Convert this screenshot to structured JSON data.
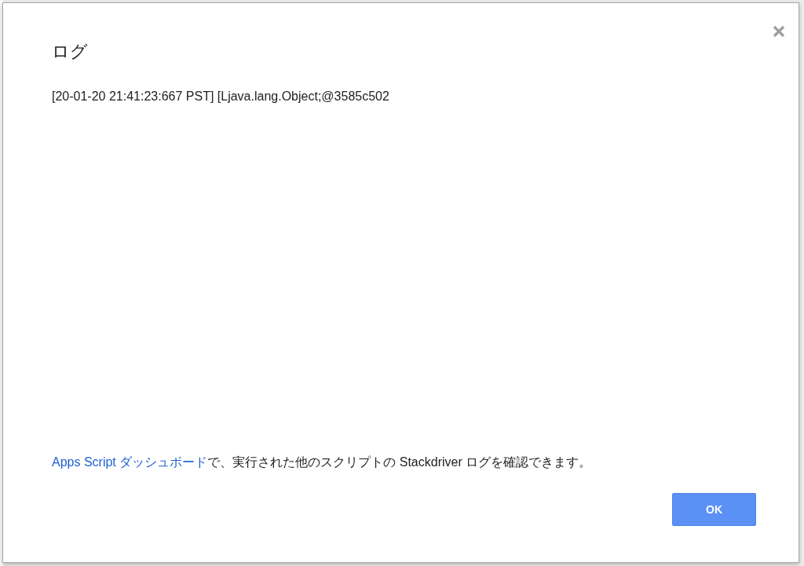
{
  "dialog": {
    "title": "ログ",
    "log_lines": [
      "[20-01-20 21:41:23:667 PST] [Ljava.lang.Object;@3585c502"
    ],
    "footer": {
      "link": "Apps Script ダッシュボード",
      "text": "で、実行された他のスクリプトの Stackdriver ログを確認できます。"
    },
    "buttons": [
      {
        "label": "OK",
        "kind": "primary"
      }
    ]
  }
}
